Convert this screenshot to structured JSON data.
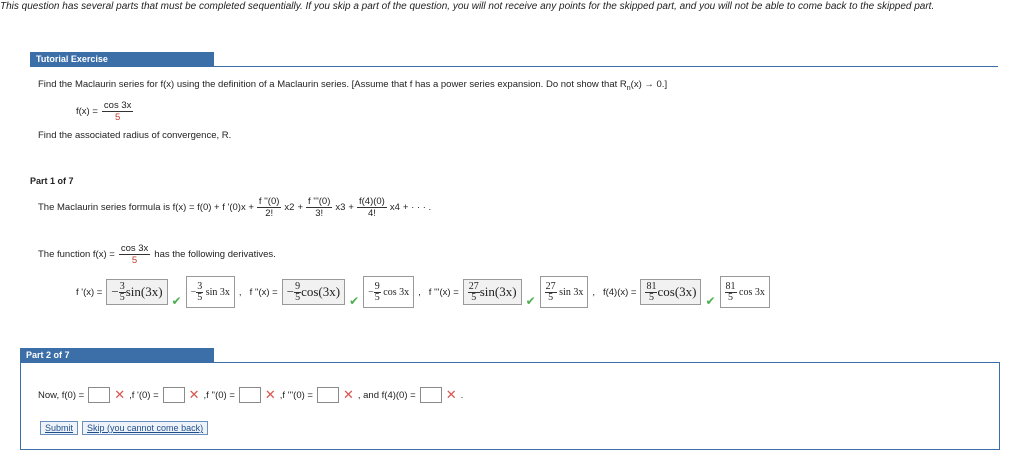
{
  "notice": "This question has several parts that must be completed sequentially. If you skip a part of the question, you will not receive any points for the skipped part, and you will not be able to come back to the skipped part.",
  "tutorial_tab": "Tutorial Exercise",
  "problem": {
    "text": "Find the Maclaurin series for f(x) using the definition of a Maclaurin series. [Assume that f has a power series expansion. Do not show that R",
    "sub_n": "n",
    "text_tail": "(x) → 0.]",
    "fx_label": "f(x) =",
    "fx_num": "cos 3x",
    "fx_den": "5",
    "radius_text": "Find the associated radius of convergence, R."
  },
  "part1": {
    "label": "Part 1 of 7",
    "formula_prefix": "The Maclaurin series formula is f(x) = f(0) + f '(0)x +",
    "t2_num": "f ''(0)",
    "t2_den": "2!",
    "t2_pow": "x2",
    "t3_num": "f '''(0)",
    "t3_den": "3!",
    "t3_pow": "x3",
    "t4_num": "f(4)(0)",
    "t4_den": "4!",
    "t4_pow": "x4",
    "formula_tail": "+ · · · .",
    "function_prefix": "The function f(x) =",
    "function_num": "cos 3x",
    "function_den": "5",
    "function_suffix": "has the following derivatives.",
    "derivs": [
      {
        "label": "f '(x) =",
        "sign": "−",
        "num": "3",
        "den": "5",
        "func": "sin(3x)",
        "given_sign": "−",
        "given_num": "3",
        "given_den": "5",
        "given_func": "sin 3x"
      },
      {
        "label": "f ''(x) =",
        "sign": "−",
        "num": "9",
        "den": "5",
        "func": "cos(3x)",
        "given_sign": "−",
        "given_num": "9",
        "given_den": "5",
        "given_func": "cos 3x"
      },
      {
        "label": "f '''(x) =",
        "sign": "",
        "num": "27",
        "den": "5",
        "func": "sin(3x)",
        "given_sign": "",
        "given_num": "27",
        "given_den": "5",
        "given_func": "sin 3x"
      },
      {
        "label": "f(4)(x) =",
        "sign": "",
        "num": "81",
        "den": "5",
        "func": "cos(3x)",
        "given_sign": "",
        "given_num": "81",
        "given_den": "5",
        "given_func": "cos 3x"
      }
    ]
  },
  "part2": {
    "label": "Part 2 of 7",
    "now": "Now, f(0) =",
    "f1": ",f '(0) =",
    "f2": ",f ''(0) =",
    "f3": ",f '''(0) =",
    "f4": ", and f(4)(0) =",
    "end": ".",
    "submit": "Submit",
    "skip": "Skip (you cannot come back)"
  },
  "colors": {
    "accent": "#3c6ea8",
    "check": "#4caf50",
    "cross": "#d9534f",
    "red": "#c0392b"
  }
}
